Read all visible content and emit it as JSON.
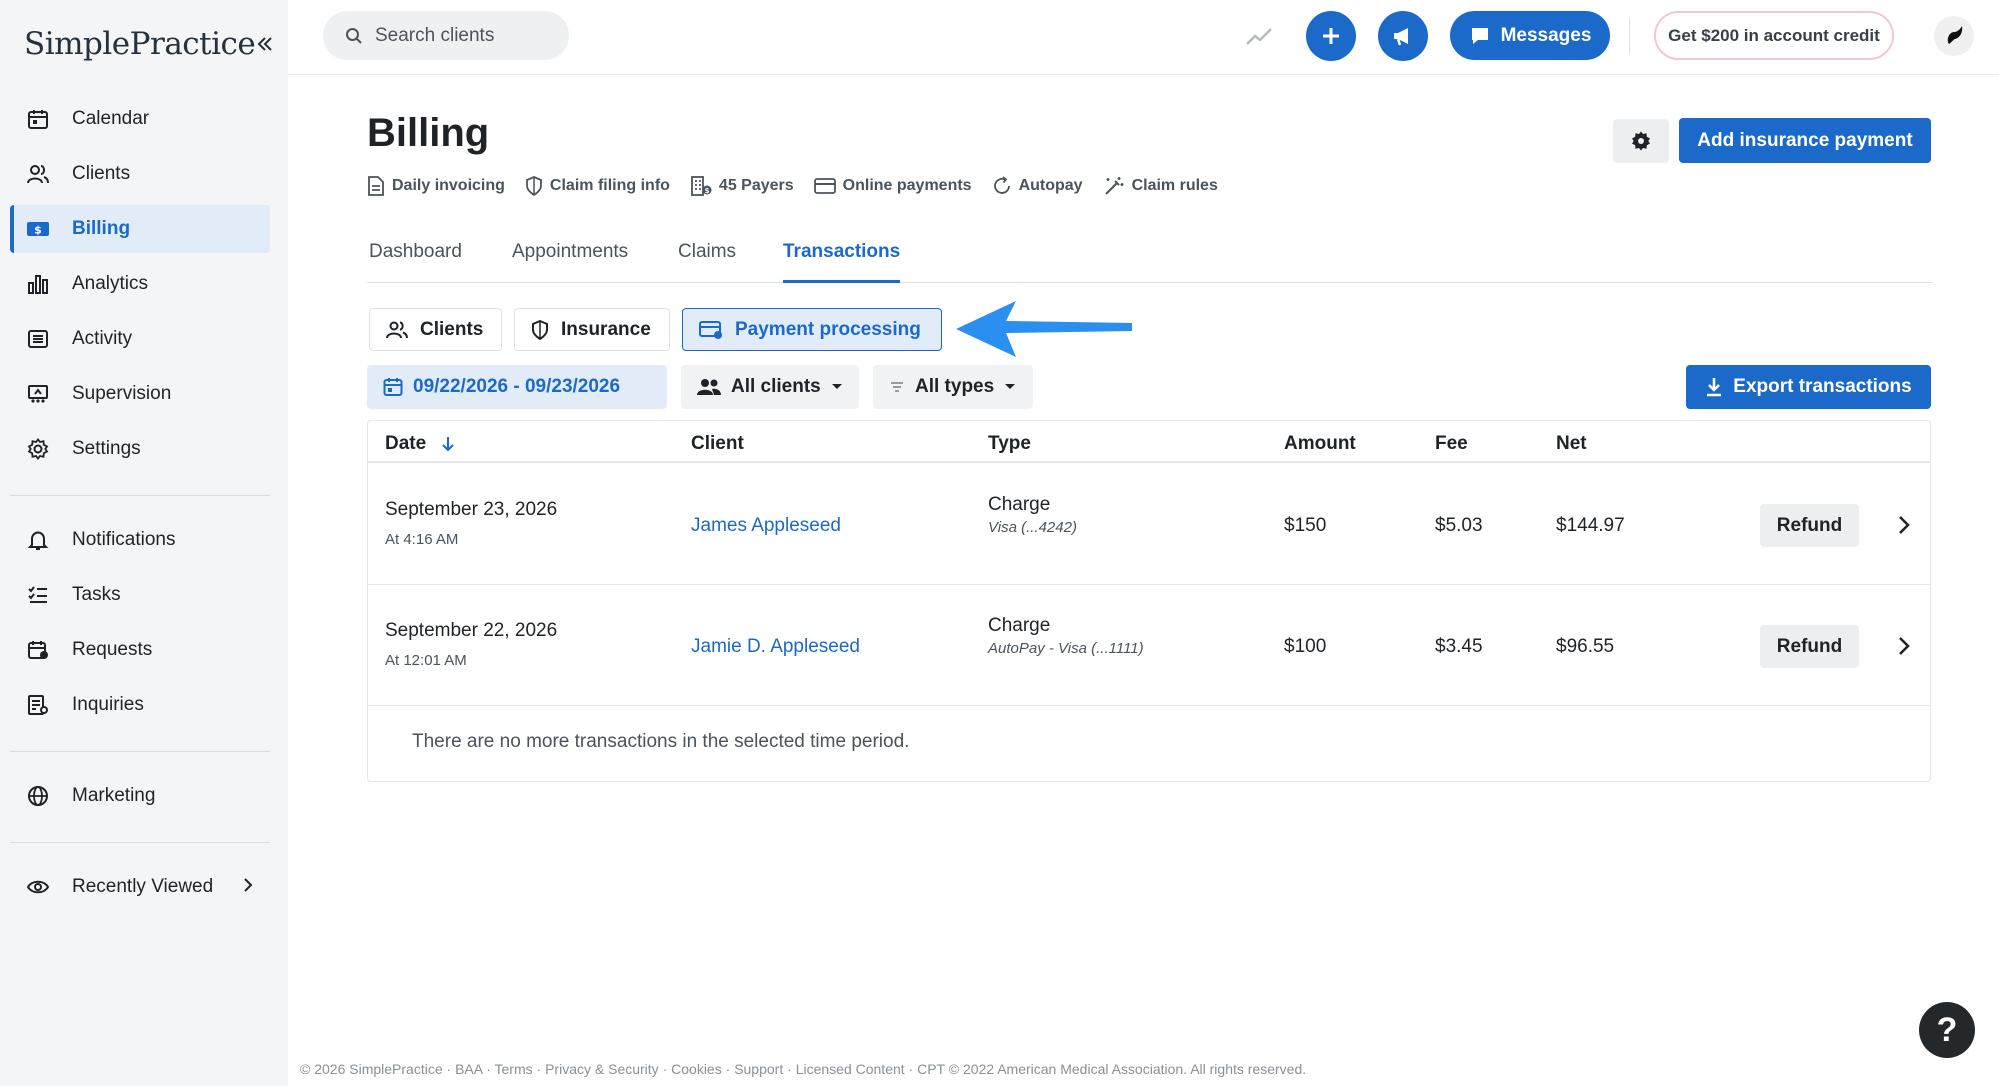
{
  "app": {
    "logo": "SimplePractice"
  },
  "sidebar": {
    "items": [
      {
        "label": "Calendar",
        "icon": "calendar-icon"
      },
      {
        "label": "Clients",
        "icon": "clients-icon"
      },
      {
        "label": "Billing",
        "icon": "billing-icon",
        "active": true
      },
      {
        "label": "Analytics",
        "icon": "analytics-icon"
      },
      {
        "label": "Activity",
        "icon": "activity-icon"
      },
      {
        "label": "Supervision",
        "icon": "supervision-icon"
      },
      {
        "label": "Settings",
        "icon": "settings-icon"
      },
      {
        "label": "Notifications",
        "icon": "bell-icon"
      },
      {
        "label": "Tasks",
        "icon": "tasks-icon"
      },
      {
        "label": "Requests",
        "icon": "requests-icon"
      },
      {
        "label": "Inquiries",
        "icon": "inquiries-icon"
      },
      {
        "label": "Marketing",
        "icon": "globe-icon"
      },
      {
        "label": "Recently Viewed",
        "icon": "eye-icon"
      }
    ]
  },
  "topbar": {
    "search_placeholder": "Search clients",
    "messages_label": "Messages",
    "credit_label": "Get $200 in account credit"
  },
  "page": {
    "title": "Billing",
    "add_payment_label": "Add insurance payment",
    "subnav": [
      {
        "label": "Daily invoicing",
        "icon": "document-icon"
      },
      {
        "label": "Claim filing info",
        "icon": "shield-icon"
      },
      {
        "label": "45 Payers",
        "icon": "building-icon"
      },
      {
        "label": "Online payments",
        "icon": "credit-card-icon"
      },
      {
        "label": "Autopay",
        "icon": "refresh-icon"
      },
      {
        "label": "Claim rules",
        "icon": "magic-wand-icon"
      }
    ],
    "tabs": [
      {
        "label": "Dashboard"
      },
      {
        "label": "Appointments"
      },
      {
        "label": "Claims"
      },
      {
        "label": "Transactions",
        "active": true
      }
    ],
    "segments": [
      {
        "label": "Clients"
      },
      {
        "label": "Insurance"
      },
      {
        "label": "Payment processing",
        "active": true
      }
    ],
    "filters": {
      "date_range": "09/22/2026 - 09/23/2026",
      "clients": "All clients",
      "types": "All types"
    },
    "export_label": "Export transactions"
  },
  "table": {
    "columns": [
      "Date",
      "Client",
      "Type",
      "Amount",
      "Fee",
      "Net"
    ],
    "rows": [
      {
        "date": "September 23, 2026",
        "time": "At 4:16 AM",
        "client": "James Appleseed",
        "type": "Charge",
        "type_detail": "Visa (...4242)",
        "amount": "$150",
        "fee": "$5.03",
        "net": "$144.97",
        "action": "Refund"
      },
      {
        "date": "September 22, 2026",
        "time": "At 12:01 AM",
        "client": "Jamie D. Appleseed",
        "type": "Charge",
        "type_detail": "AutoPay - Visa (...1111)",
        "amount": "$100",
        "fee": "$3.45",
        "net": "$96.55",
        "action": "Refund"
      }
    ],
    "empty_message": "There are no more transactions in the selected time period."
  },
  "footer": {
    "copyright": "© 2026 SimplePractice",
    "links": [
      "BAA",
      "Terms",
      "Privacy & Security",
      "Cookies",
      "Support",
      "Licensed Content"
    ],
    "cpt": "CPT © 2022 American Medical Association. All rights reserved."
  },
  "help_label": "?",
  "colors": {
    "brand_blue": "#1b6ac9",
    "callout_arrow": "#2b8ff0"
  }
}
